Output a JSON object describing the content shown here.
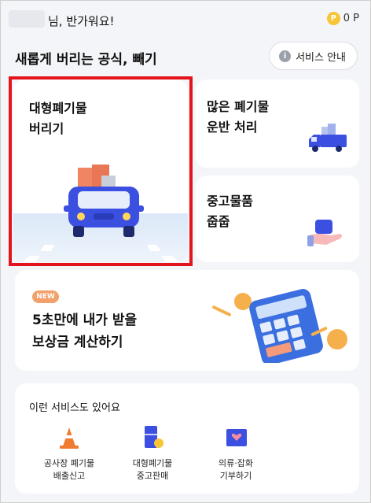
{
  "header": {
    "greeting": "님, 반가워요!",
    "points_value": "0 P",
    "coin_symbol": "P"
  },
  "title": "새롭게 버리는 공식, 빼기",
  "service_guide": {
    "label": "서비스 안내",
    "icon": "info-icon"
  },
  "cards": {
    "large_waste": {
      "label": "대형폐기물\n버리기",
      "icon": "truck-icon"
    },
    "much_waste": {
      "label": "많은 폐기물\n운반 처리",
      "icon": "delivery-truck-icon"
    },
    "used_items": {
      "label": "중고물품\n줍줍",
      "icon": "hand-box-icon"
    },
    "compensation": {
      "badge": "NEW",
      "label": "5초만에 내가 받을\n보상금 계산하기",
      "icon": "calculator-icon"
    }
  },
  "more_services": {
    "title": "이런 서비스도 있어요",
    "items": [
      {
        "label": "공사장 폐기물\n배출신고",
        "icon": "traffic-cone-icon"
      },
      {
        "label": "대형폐기물\n중고판매",
        "icon": "fridge-coin-icon"
      },
      {
        "label": "의류·잡화\n기부하기",
        "icon": "donation-box-icon"
      }
    ]
  },
  "colors": {
    "background": "#f4f5f8",
    "highlight": "#e3141b",
    "truck_blue": "#3b4fe0",
    "coin": "#f7c536",
    "new_badge": "#f2a16b"
  }
}
